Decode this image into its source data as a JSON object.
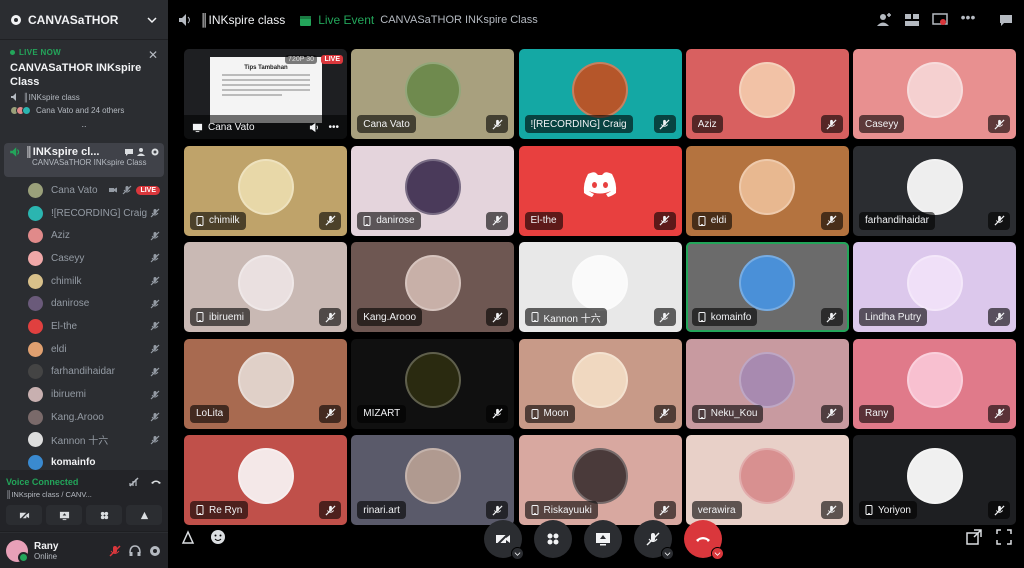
{
  "server": {
    "name": "CANVASaTHOR"
  },
  "live_card": {
    "badge": "LIVE NOW",
    "event_name": "CANVASaTHOR INKspire Class",
    "channel": "║INKspire class",
    "people": "Cana Vato and 24 others",
    "dots": ".."
  },
  "voice_channel": {
    "name": "║INKspire cl...",
    "subtitle": "CANVASaTHOR INKspire Class"
  },
  "members": [
    {
      "name": "Cana Vato",
      "color": "#9aa07a",
      "live": true,
      "live_label": "LIVE"
    },
    {
      "name": "![RECORDING] Craig",
      "color": "#2bb5b0"
    },
    {
      "name": "Aziz",
      "color": "#e08a8a"
    },
    {
      "name": "Caseyy",
      "color": "#f0a8a8"
    },
    {
      "name": "chimilk",
      "color": "#d8c08a"
    },
    {
      "name": "danirose",
      "color": "#6a5a7a"
    },
    {
      "name": "El-the",
      "color": "#e0403f"
    },
    {
      "name": "eldi",
      "color": "#e0a070"
    },
    {
      "name": "farhandihaidar",
      "color": "#444"
    },
    {
      "name": "ibiruemi",
      "color": "#c8b0b0"
    },
    {
      "name": "Kang.Arooo",
      "color": "#7a6a6a"
    },
    {
      "name": "Kannon 十六",
      "color": "#ddd"
    },
    {
      "name": "komainfo",
      "color": "#3a8ad0",
      "active": true
    }
  ],
  "voice_panel": {
    "title": "Voice Connected",
    "sub": "║INKspire class / CANV..."
  },
  "user": {
    "name": "Rany",
    "status": "Online"
  },
  "topbar": {
    "channel": "║INKspire class",
    "event_label": "Live Event",
    "event_title": "CANVASaTHOR INKspire Class"
  },
  "stream": {
    "name": "Cana Vato",
    "resolution": "720P 30",
    "live_label": "LIVE",
    "slide_title": "Tips Tambahan"
  },
  "tiles": [
    {
      "name": "Cana Vato",
      "bg": "#a8a07e",
      "av": "#6f8a4e",
      "phone": false
    },
    {
      "name": "![RECORDING] Craig",
      "bg": "#14a8a4",
      "av": "#b5562a",
      "phone": false
    },
    {
      "name": "Aziz",
      "bg": "#d86060",
      "av": "#f2c2a6",
      "phone": false
    },
    {
      "name": "Caseyy",
      "bg": "#e89090",
      "av": "#f5d0d0",
      "phone": false
    },
    {
      "name": "chimilk",
      "bg": "#bfa36a",
      "av": "#e8d8a8",
      "phone": true
    },
    {
      "name": "danirose",
      "bg": "#e4d4dc",
      "av": "#4a3a5a",
      "phone": true
    },
    {
      "name": "El-the",
      "bg": "#e8403f",
      "av": "",
      "phone": false,
      "discord": true
    },
    {
      "name": "eldi",
      "bg": "#b4733f",
      "av": "#e8b890",
      "phone": true
    },
    {
      "name": "farhandihaidar",
      "bg": "#2b2d31",
      "av": "#eee",
      "phone": false
    },
    {
      "name": "ibiruemi",
      "bg": "#c9b9b4",
      "av": "#eae0e0",
      "phone": true
    },
    {
      "name": "Kang.Arooo",
      "bg": "#6e5752",
      "av": "#c8b0a8",
      "phone": false
    },
    {
      "name": "Kannon 十六",
      "bg": "#e8e8e8",
      "av": "#fafafa",
      "phone": true
    },
    {
      "name": "komainfo",
      "bg": "#6b6b6b",
      "av": "#4a90d8",
      "phone": true,
      "speaking": true
    },
    {
      "name": "Lindha Putry",
      "bg": "#dcc8ec",
      "av": "#f0e0f8",
      "phone": false
    },
    {
      "name": "LoLita",
      "bg": "#a86a50",
      "av": "#e0d0c8",
      "phone": false
    },
    {
      "name": "MIZART",
      "bg": "#101010",
      "av": "#2a2a10",
      "phone": false
    },
    {
      "name": "Moon",
      "bg": "#c89a88",
      "av": "#f0d8c0",
      "phone": true
    },
    {
      "name": "Neku_Kou",
      "bg": "#c89aa0",
      "av": "#a88ab0",
      "phone": true
    },
    {
      "name": "Rany",
      "bg": "#e07a8a",
      "av": "#f8c0d0",
      "phone": false
    },
    {
      "name": "Re Ryn",
      "bg": "#c0504a",
      "av": "#f4e8e8",
      "phone": true
    },
    {
      "name": "rinari.art",
      "bg": "#5a5a6a",
      "av": "#b09a90",
      "phone": false
    },
    {
      "name": "Riskayuuki",
      "bg": "#d8a8a0",
      "av": "#4a3a3a",
      "phone": true
    },
    {
      "name": "verawira",
      "bg": "#e8d0c8",
      "av": "#d89090",
      "phone": false
    },
    {
      "name": "Yoriyon",
      "bg": "#1e1f22",
      "av": "#f0f0f0",
      "phone": true
    }
  ],
  "colors": {
    "green": "#23a55a",
    "red": "#da373c",
    "sidebar": "#2b2d31"
  }
}
